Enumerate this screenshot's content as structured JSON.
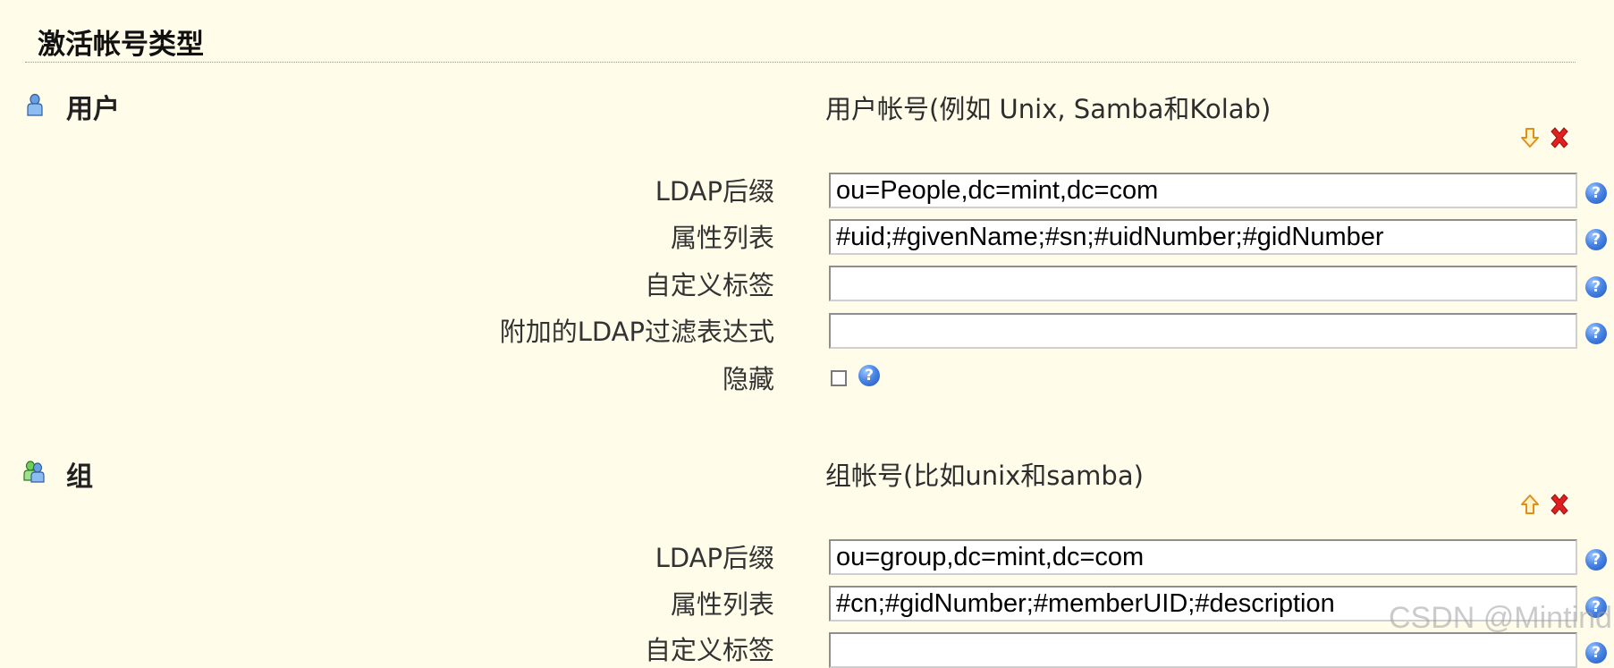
{
  "page": {
    "title": "激活帐号类型"
  },
  "account_types": [
    {
      "name": "用户",
      "icon": "user-icon",
      "description": "用户帐号(例如 Unix, Samba和Kolab)",
      "move_icon": "move-down-arrow-icon",
      "delete_icon": "delete-x-icon",
      "fields": {
        "ldap_suffix": {
          "label": "LDAP后缀",
          "value": "ou=People,dc=mint,dc=com"
        },
        "attributes": {
          "label": "属性列表",
          "value": "#uid;#givenName;#sn;#uidNumber;#gidNumber"
        },
        "custom_label": {
          "label": "自定义标签",
          "value": ""
        },
        "extra_filter": {
          "label": "附加的LDAP过滤表达式",
          "value": ""
        },
        "hidden": {
          "label": "隐藏",
          "checked": false
        }
      }
    },
    {
      "name": "组",
      "icon": "group-icon",
      "description": "组帐号(比如unix和samba)",
      "move_icon": "move-up-arrow-icon",
      "delete_icon": "delete-x-icon",
      "fields": {
        "ldap_suffix": {
          "label": "LDAP后缀",
          "value": "ou=group,dc=mint,dc=com"
        },
        "attributes": {
          "label": "属性列表",
          "value": "#cn;#gidNumber;#memberUID;#description"
        },
        "custom_label": {
          "label": "自定义标签",
          "value": ""
        }
      }
    }
  ],
  "watermark": "CSDN @Mintind",
  "colors": {
    "background": "#fffdea",
    "delete": "#e02020",
    "arrow": "#e8a020",
    "help": "#3a78d8"
  }
}
